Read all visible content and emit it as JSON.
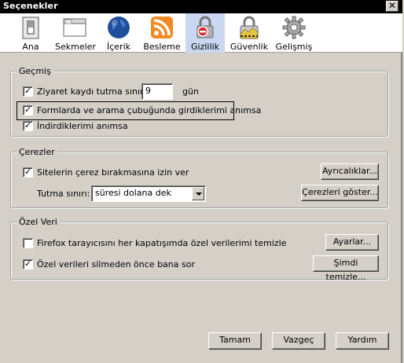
{
  "window": {
    "title": "Seçenekler",
    "close_glyph": "✕"
  },
  "tabs": [
    {
      "label": "Ana",
      "icon": "home-switch-icon"
    },
    {
      "label": "Sekmeler",
      "icon": "tabs-window-icon"
    },
    {
      "label": "İçerik",
      "icon": "globe-icon"
    },
    {
      "label": "Besleme",
      "icon": "rss-feed-icon"
    },
    {
      "label": "Gizlilik",
      "icon": "privacy-lock-icon",
      "selected": true
    },
    {
      "label": "Güvenlik",
      "icon": "security-padlock-icon"
    },
    {
      "label": "Gelişmiş",
      "icon": "gear-icon"
    }
  ],
  "history": {
    "legend": "Geçmiş",
    "visit_limit_label": "Ziyaret kaydı tutma sınırı:",
    "visit_limit_value": "9",
    "visit_limit_unit": "gün",
    "visit_limit_checked": true,
    "forms_label": "Formlarda ve arama çubuğunda girdiklerimi anımsa",
    "forms_checked": true,
    "downloads_label": "İndirdiklerimi anımsa",
    "downloads_checked": true
  },
  "cookies": {
    "legend": "Çerezler",
    "accept_label": "Sitelerin çerez bırakmasına izin ver",
    "accept_checked": true,
    "exceptions_button": "Ayrıcalıklar...",
    "keep_until_label": "Tutma sınırı:",
    "keep_until_value": "süresi dolana dek",
    "show_cookies_button": "Çerezleri göster..."
  },
  "private_data": {
    "legend": "Özel Veri",
    "clear_on_close_label": "Firefox tarayıcısını her kapatışımda özel verilerimi temizle",
    "clear_on_close_checked": false,
    "settings_button": "Ayarlar...",
    "ask_before_label": "Özel verileri silmeden önce bana sor",
    "ask_before_checked": true,
    "clear_now_button": "Şimdi temizle..."
  },
  "footer": {
    "ok": "Tamam",
    "cancel": "Vazgeç",
    "help": "Yardım"
  },
  "colors": {
    "selected_tab": "#c9d8f0",
    "titlebar": "#000000",
    "dialog_bg": "#d4d0c8"
  }
}
